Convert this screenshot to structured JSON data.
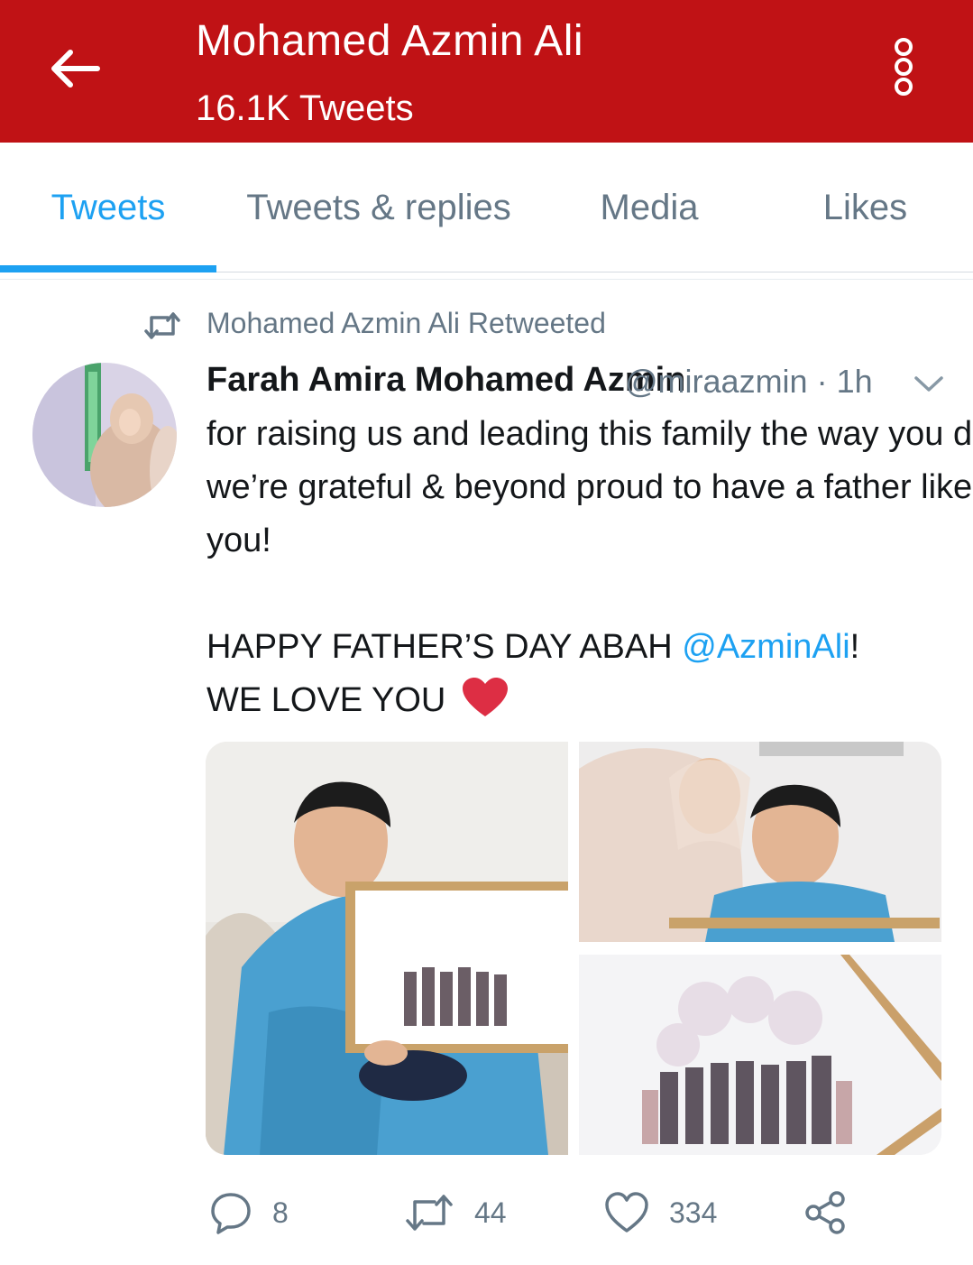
{
  "header": {
    "title": "Mohamed Azmin Ali",
    "subtitle": "16.1K Tweets",
    "background_color": "#c01215",
    "back_icon": "arrow-left-icon",
    "menu_icon": "more-vertical-icon"
  },
  "tabs": [
    {
      "label": "Tweets",
      "active": true
    },
    {
      "label": "Tweets & replies",
      "active": false
    },
    {
      "label": "Media",
      "active": false
    },
    {
      "label": "Likes",
      "active": false
    }
  ],
  "accent_color": "#1da1f2",
  "tweet": {
    "retweet_label": "Mohamed Azmin Ali Retweeted",
    "author_name": "Farah Amira Mohamed Azmin",
    "author_handle_time": "@miraazmin · 1h",
    "text_lines": [
      "for raising us and leading this family the way you do,",
      "we’re grateful & beyond proud to have a father like",
      "you!"
    ],
    "greeting_prefix": "HAPPY FATHER’S DAY ABAH ",
    "mention": "@AzminAli",
    "greeting_suffix": "!",
    "closing": "WE LOVE YOU ",
    "closing_emoji": "red-heart-icon",
    "media_count": 3,
    "actions": {
      "replies": "8",
      "retweets": "44",
      "likes": "334"
    }
  }
}
